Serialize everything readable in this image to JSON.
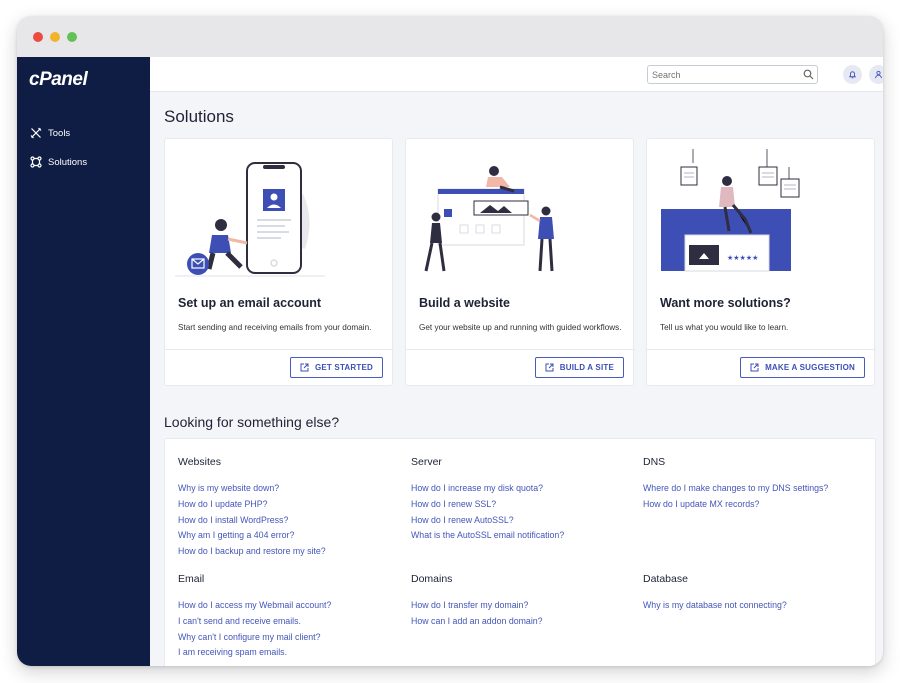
{
  "window": {
    "controls": [
      "close",
      "minimize",
      "maximize"
    ]
  },
  "sidebar": {
    "logo": "cPanel",
    "items": [
      {
        "label": "Tools",
        "icon": "tools-icon"
      },
      {
        "label": "Solutions",
        "icon": "solutions-icon"
      }
    ]
  },
  "header": {
    "search": {
      "placeholder": "Search",
      "value": ""
    },
    "icons": [
      "bell-icon",
      "user-icon"
    ]
  },
  "main": {
    "title": "Solutions",
    "cards": [
      {
        "title": "Set up an email account",
        "description": "Start sending and receiving emails from your domain.",
        "button": "GET STARTED"
      },
      {
        "title": "Build a website",
        "description": "Get your website up and running with guided workflows.",
        "button": "BUILD A SITE"
      },
      {
        "title": "Want more solutions?",
        "description": "Tell us what you would like to learn.",
        "button": "MAKE A SUGGESTION"
      }
    ],
    "help_title": "Looking for something else?",
    "help_groups": [
      {
        "title": "Websites",
        "links": [
          "Why is my website down?",
          "How do I update PHP?",
          "How do I install WordPress?",
          "Why am I getting a 404 error?",
          "How do I backup and restore my site?"
        ]
      },
      {
        "title": "Server",
        "links": [
          "How do I increase my disk quota?",
          "How do I renew SSL?",
          "How do I renew AutoSSL?",
          "What is the AutoSSL email notification?"
        ]
      },
      {
        "title": "DNS",
        "links": [
          "Where do I make changes to my DNS settings?",
          "How do I update MX records?"
        ]
      },
      {
        "title": "Email",
        "links": [
          "How do I access my Webmail account?",
          "I can't send and receive emails.",
          "Why can't I configure my mail client?",
          "I am receiving spam emails."
        ]
      },
      {
        "title": "Domains",
        "links": [
          "How do I transfer my domain?",
          "How can I add an addon domain?"
        ]
      },
      {
        "title": "Database",
        "links": [
          "Why is my database not connecting?"
        ]
      }
    ]
  },
  "colors": {
    "sidebar": "#0f1d45",
    "accent": "#3d4fb5",
    "link": "#4356b8",
    "background": "#f4f5f8"
  }
}
